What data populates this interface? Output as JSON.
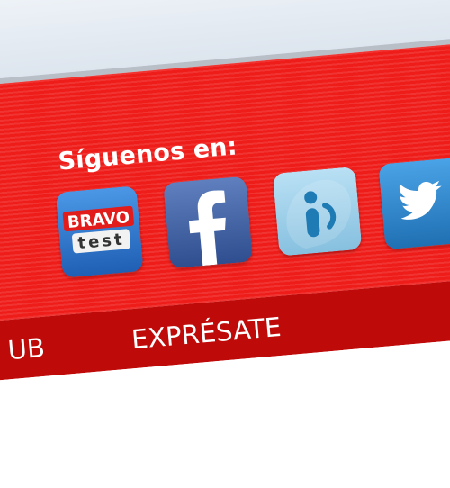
{
  "header": {
    "follow_label": "Síguenos en:"
  },
  "social": [
    {
      "name": "Bravo Test",
      "icon": "bravo-test-icon",
      "badge_top": "BRAVO",
      "badge_bottom": "test",
      "color": "#2a72c8"
    },
    {
      "name": "Facebook",
      "icon": "facebook-icon",
      "color": "#3b5998"
    },
    {
      "name": "Tuenti",
      "icon": "tuenti-icon",
      "color": "#9fcfe9"
    },
    {
      "name": "Twitter",
      "icon": "twitter-icon",
      "color": "#2f86c8"
    }
  ],
  "nav": {
    "items": [
      {
        "label": "UB"
      },
      {
        "label": "EXPRÉSATE"
      }
    ]
  },
  "colors": {
    "band": "#ee1d1a",
    "nav": "#bf0a0a",
    "text": "#ffffff"
  }
}
